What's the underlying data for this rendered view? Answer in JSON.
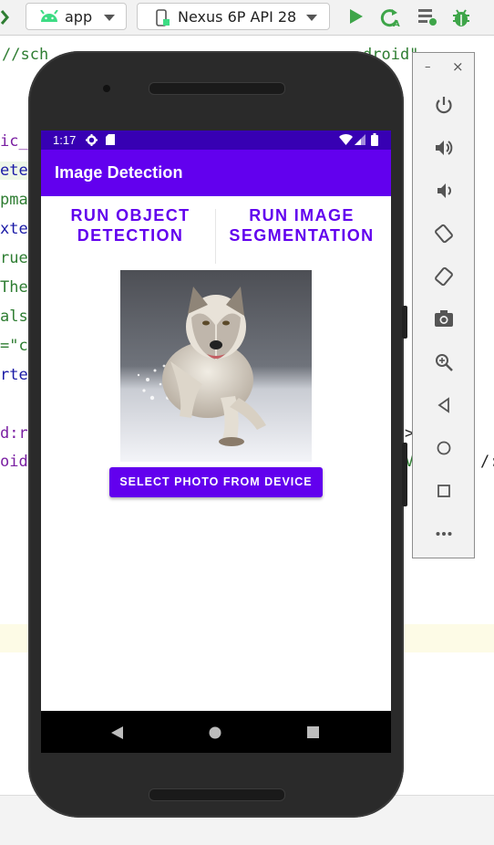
{
  "ide": {
    "module_combo": {
      "label": "app",
      "icon": "android-icon"
    },
    "device_combo": {
      "label": "Nexus 6P API 28",
      "icon": "device-icon"
    },
    "toolbar_icons": [
      "run-icon",
      "apply-changes-icon",
      "profiler-icon",
      "debug-icon"
    ],
    "code_fragments": {
      "top": "//sch",
      "top_right": "droid\"",
      "lines": [
        "ic_",
        "ete",
        "pma",
        "xte",
        "rue",
        "The",
        "als",
        "=\"c",
        "rte",
        "",
        "d:r",
        "oid"
      ],
      "right_gt": ">",
      "right_v": "V",
      "right_slash": "/:"
    },
    "colors": {
      "accent": "#6200ee",
      "status": "#3700b3"
    }
  },
  "emulator_panel": {
    "minimize": "–",
    "close": "×",
    "icons": [
      "power-icon",
      "volume-up-icon",
      "volume-down-icon",
      "rotate-left-icon",
      "rotate-right-icon",
      "screenshot-icon",
      "zoom-icon",
      "back-icon",
      "home-icon",
      "overview-icon",
      "more-icon"
    ]
  },
  "device": {
    "status_bar": {
      "time": "1:17"
    },
    "app_bar": {
      "title": "Image Detection"
    },
    "tabs": {
      "object_detection": {
        "line1": "RUN OBJECT",
        "line2": "DETECTION"
      },
      "segmentation": {
        "line1": "RUN IMAGE",
        "line2": "SEGMENTATION"
      }
    },
    "select_button": "SELECT PHOTO FROM DEVICE"
  }
}
